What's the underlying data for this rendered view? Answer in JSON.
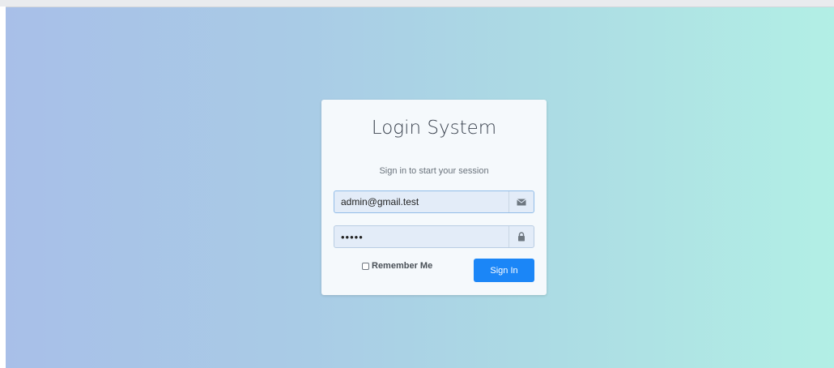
{
  "login": {
    "title": "Login System",
    "subtitle": "Sign in to start your session",
    "email": {
      "value": "admin@gmail.test",
      "icon": "envelope-icon"
    },
    "password": {
      "value": "•••••",
      "icon": "lock-icon"
    },
    "remember_label": "Remember Me",
    "sign_in_label": "Sign In"
  },
  "colors": {
    "accent": "#1b86f7",
    "background_start": "#a8bfe8",
    "background_end": "#b2efe5",
    "card": "#f5f9fc"
  }
}
